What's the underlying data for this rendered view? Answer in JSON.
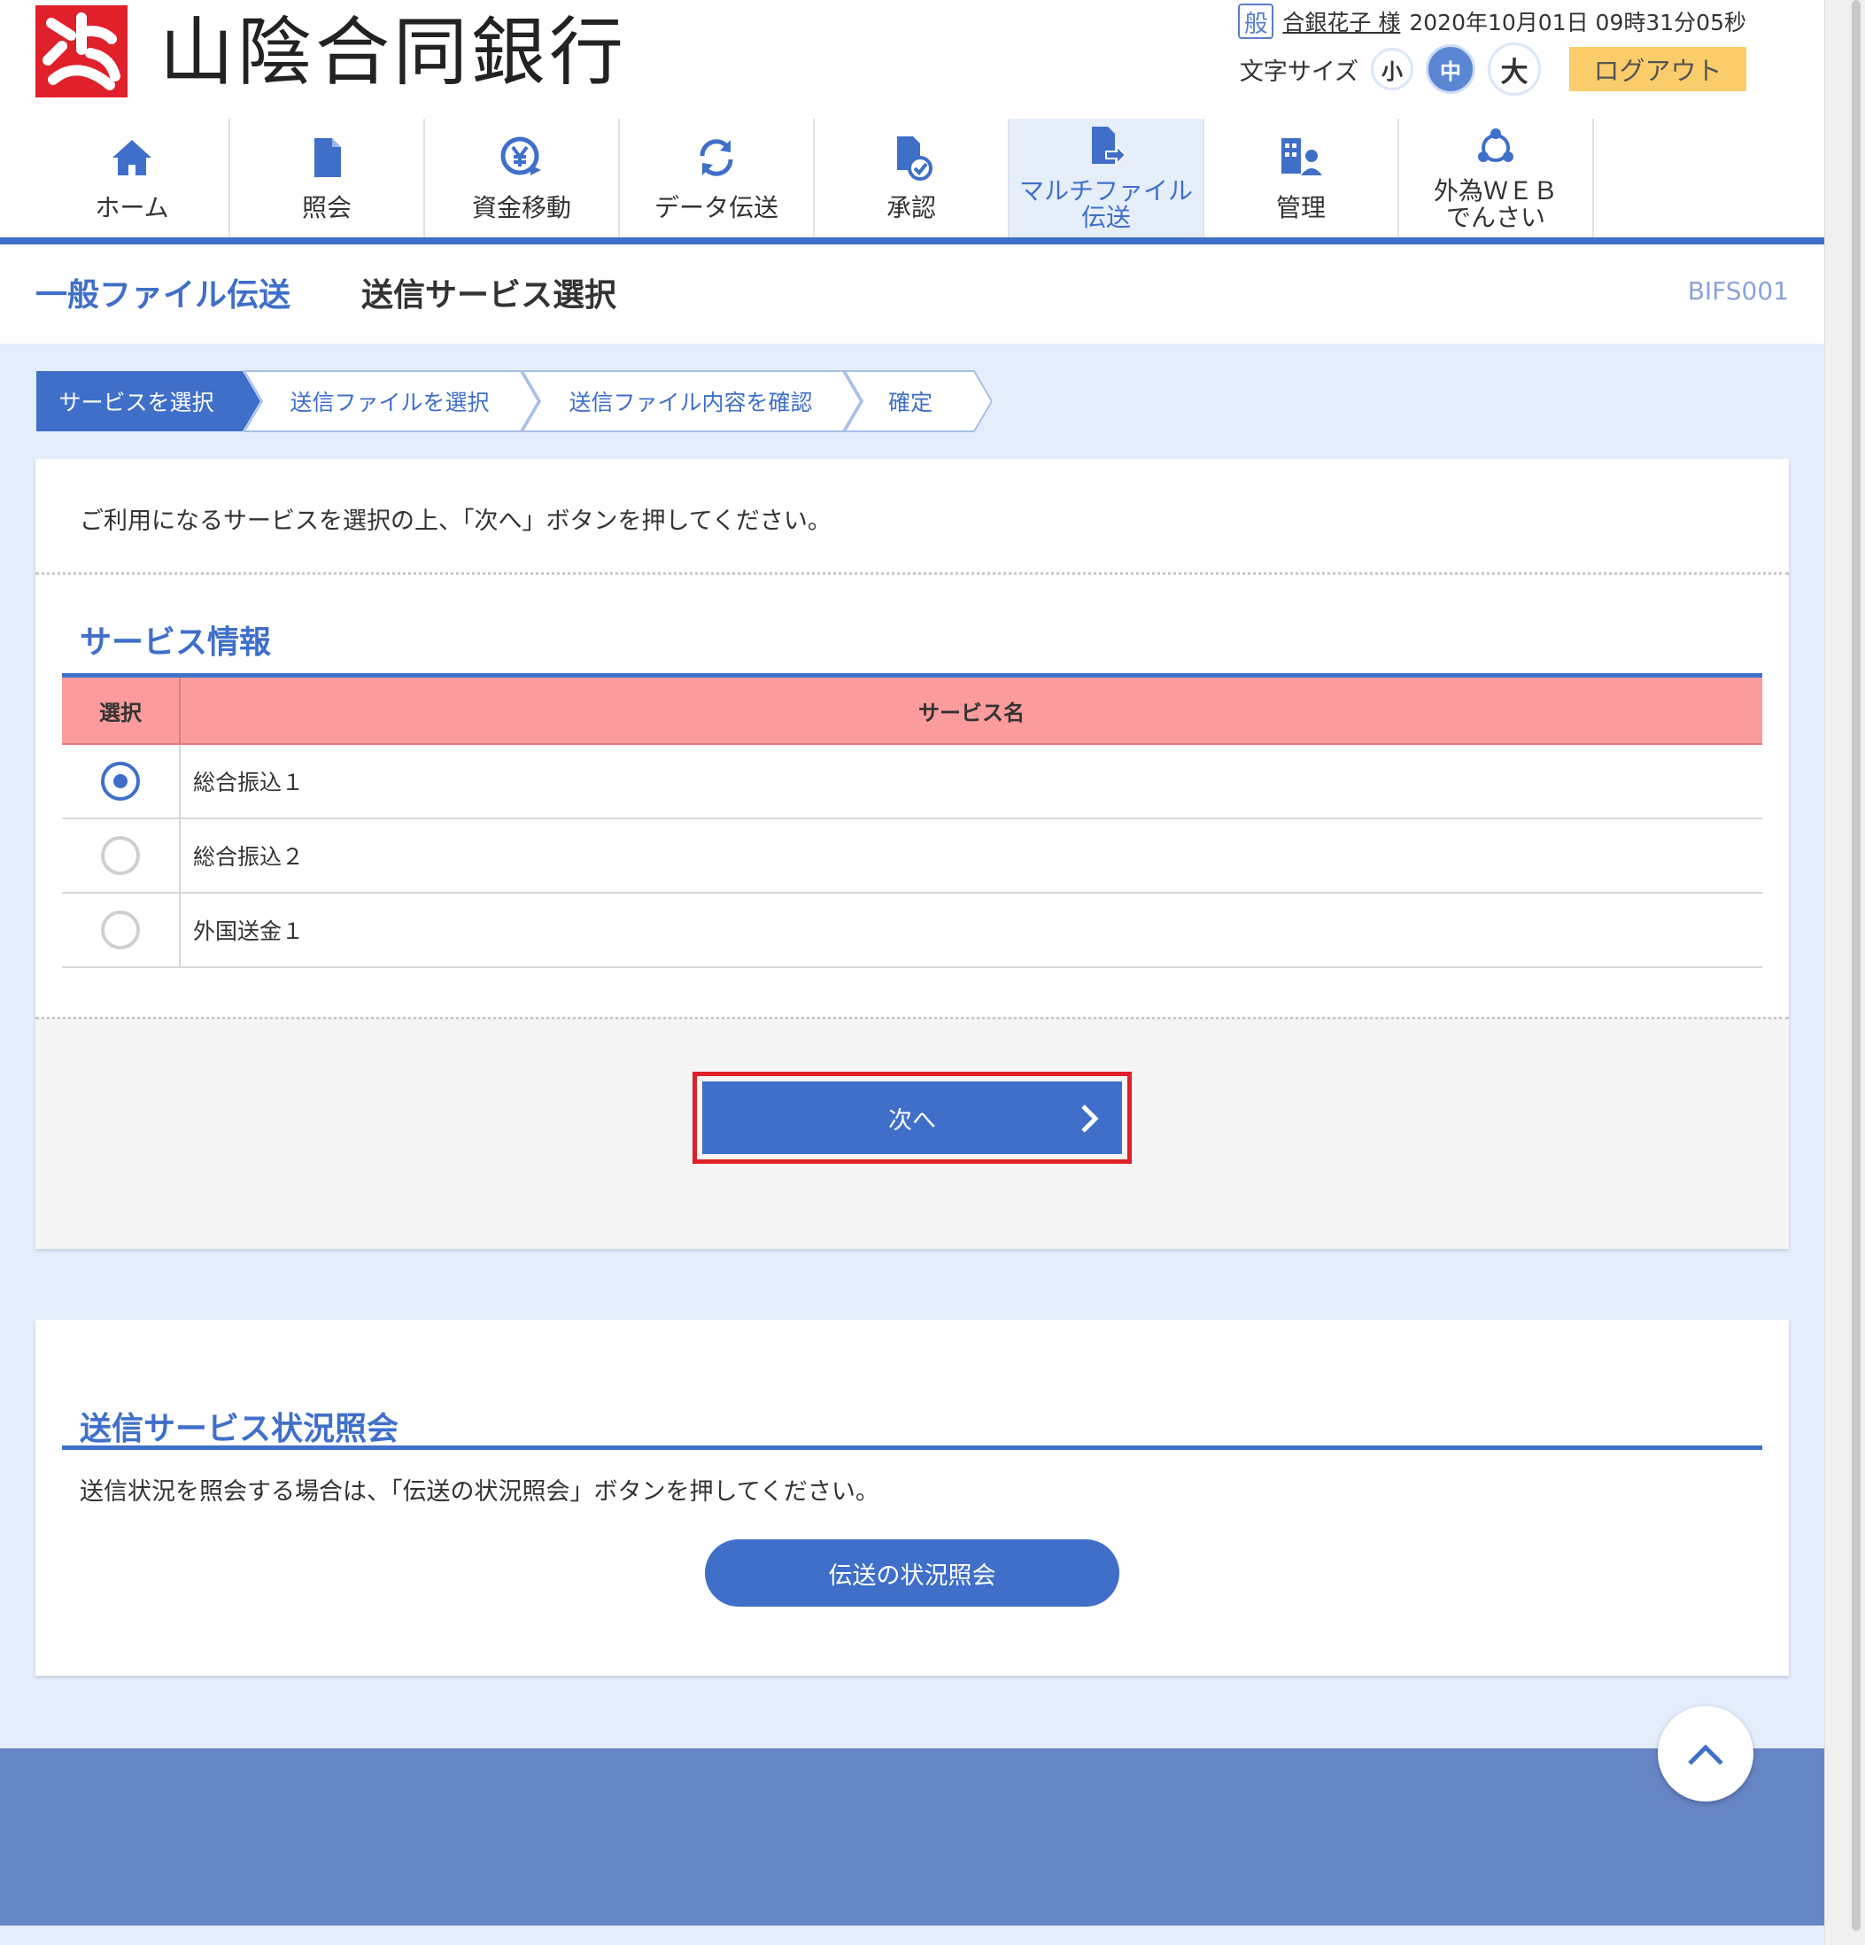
{
  "header": {
    "bank_name": "山陰合同銀行",
    "user_badge": "般",
    "user_name": "合銀花子 様",
    "datetime": "2020年10月01日 09時31分05秒",
    "font_size_label": "文字サイズ",
    "font_small": "小",
    "font_medium": "中",
    "font_large": "大",
    "logout_label": "ログアウト"
  },
  "nav": {
    "home": "ホーム",
    "inquiry": "照会",
    "fund_transfer": "資金移動",
    "data_transfer": "データ伝送",
    "approval": "承認",
    "multi_file_line1": "マルチファイル",
    "multi_file_line2": "伝送",
    "admin": "管理",
    "forex_line1": "外為ＷＥＢ",
    "forex_line2": "でんさい"
  },
  "title": {
    "main": "一般ファイル伝送",
    "sub": "送信サービス選択",
    "code": "BIFS001"
  },
  "steps": [
    "サービスを選択",
    "送信ファイルを選択",
    "送信ファイル内容を確認",
    "確定"
  ],
  "main": {
    "intro": "ご利用になるサービスを選択の上、「次へ」ボタンを押してください。",
    "section_title": "サービス情報",
    "col_select": "選択",
    "col_service": "サービス名",
    "rows": [
      {
        "name": "総合振込１",
        "selected": true
      },
      {
        "name": "総合振込２",
        "selected": false
      },
      {
        "name": "外国送金１",
        "selected": false
      }
    ],
    "next_label": "次へ"
  },
  "status": {
    "section_title": "送信サービス状況照会",
    "desc": "送信状況を照会する場合は、「伝送の状況照会」ボタンを押してください。",
    "button_label": "伝送の状況照会"
  },
  "colors": {
    "accent": "#3f6fc9",
    "table_header": "#fb9b9b",
    "logout": "#fbcd6a",
    "highlight": "#e0202a"
  }
}
